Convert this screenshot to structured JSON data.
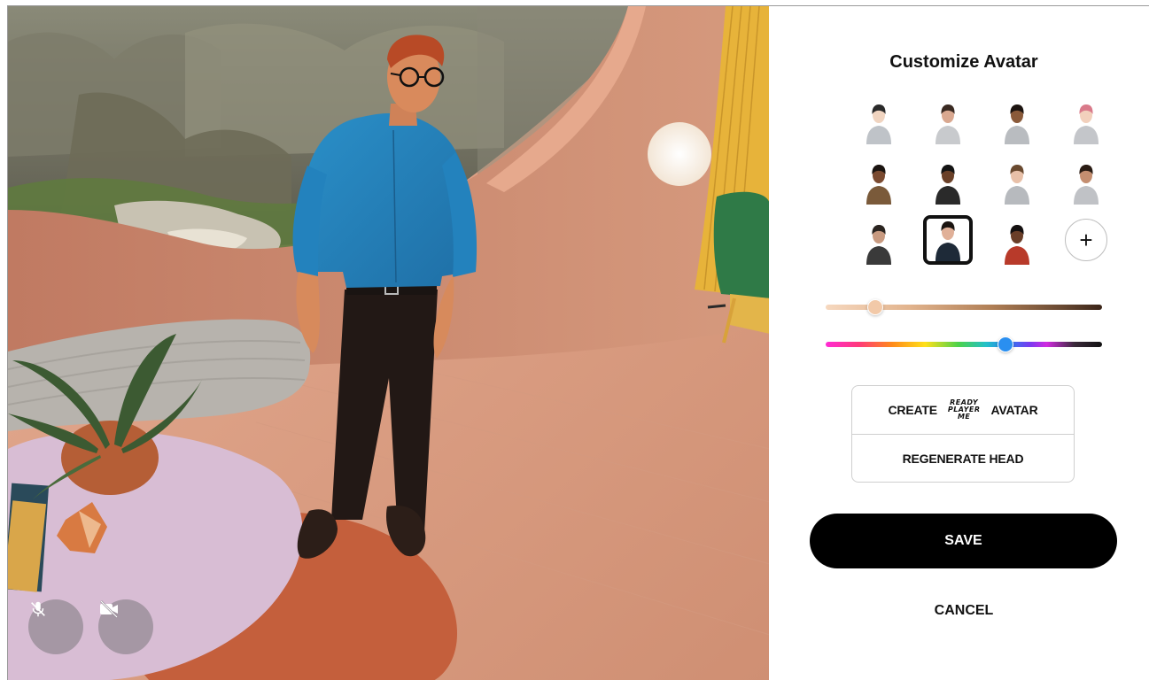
{
  "panel": {
    "title": "Customize Avatar",
    "avatar_presets": [
      {
        "name": "preset-1",
        "hair": "#2a2a2a",
        "skin": "#f0d4c0",
        "top": "#bfc3c8",
        "selected": false
      },
      {
        "name": "preset-2",
        "hair": "#3a2a22",
        "skin": "#d9a890",
        "top": "#c8cacd",
        "selected": false
      },
      {
        "name": "preset-3",
        "hair": "#1c1410",
        "skin": "#8a5a3a",
        "top": "#b9bcc0",
        "selected": false
      },
      {
        "name": "preset-4",
        "hair": "#d97a8a",
        "skin": "#f2d0bc",
        "top": "#c4c6ca",
        "selected": false
      },
      {
        "name": "preset-5",
        "hair": "#1a1410",
        "skin": "#7a4a30",
        "top": "#7a5a3a",
        "selected": false
      },
      {
        "name": "preset-6",
        "hair": "#141414",
        "skin": "#6a4028",
        "top": "#2a2a2a",
        "selected": false
      },
      {
        "name": "preset-7",
        "hair": "#6a4a30",
        "skin": "#e8c0a8",
        "top": "#b7babe",
        "selected": false
      },
      {
        "name": "preset-8",
        "hair": "#2a1c14",
        "skin": "#c48e70",
        "top": "#c0c2c6",
        "selected": false
      },
      {
        "name": "preset-9",
        "hair": "#2a2420",
        "skin": "#c89a80",
        "top": "#3a3a3a",
        "selected": false
      },
      {
        "name": "preset-10",
        "hair": "#1a1410",
        "skin": "#e0b098",
        "top": "#1e2a38",
        "selected": true
      },
      {
        "name": "preset-11",
        "hair": "#141010",
        "skin": "#6a3e28",
        "top": "#b83a2a",
        "selected": false
      }
    ],
    "add_avatar_label": "+",
    "sliders": {
      "skin_tone": {
        "value": 0.18,
        "thumb_color": "#f2c9a8"
      },
      "hair_color": {
        "value": 0.65,
        "thumb_color": "#2a8ff0"
      }
    },
    "create_prefix": "CREATE",
    "rpm_logo": [
      "READY",
      "PLAYER",
      "ME"
    ],
    "create_suffix": "AVATAR",
    "regenerate_label": "REGENERATE HEAD",
    "save_label": "SAVE",
    "cancel_label": "CANCEL"
  },
  "scene": {
    "mic_icon": "mic-off-icon",
    "camera_icon": "video-off-icon"
  }
}
